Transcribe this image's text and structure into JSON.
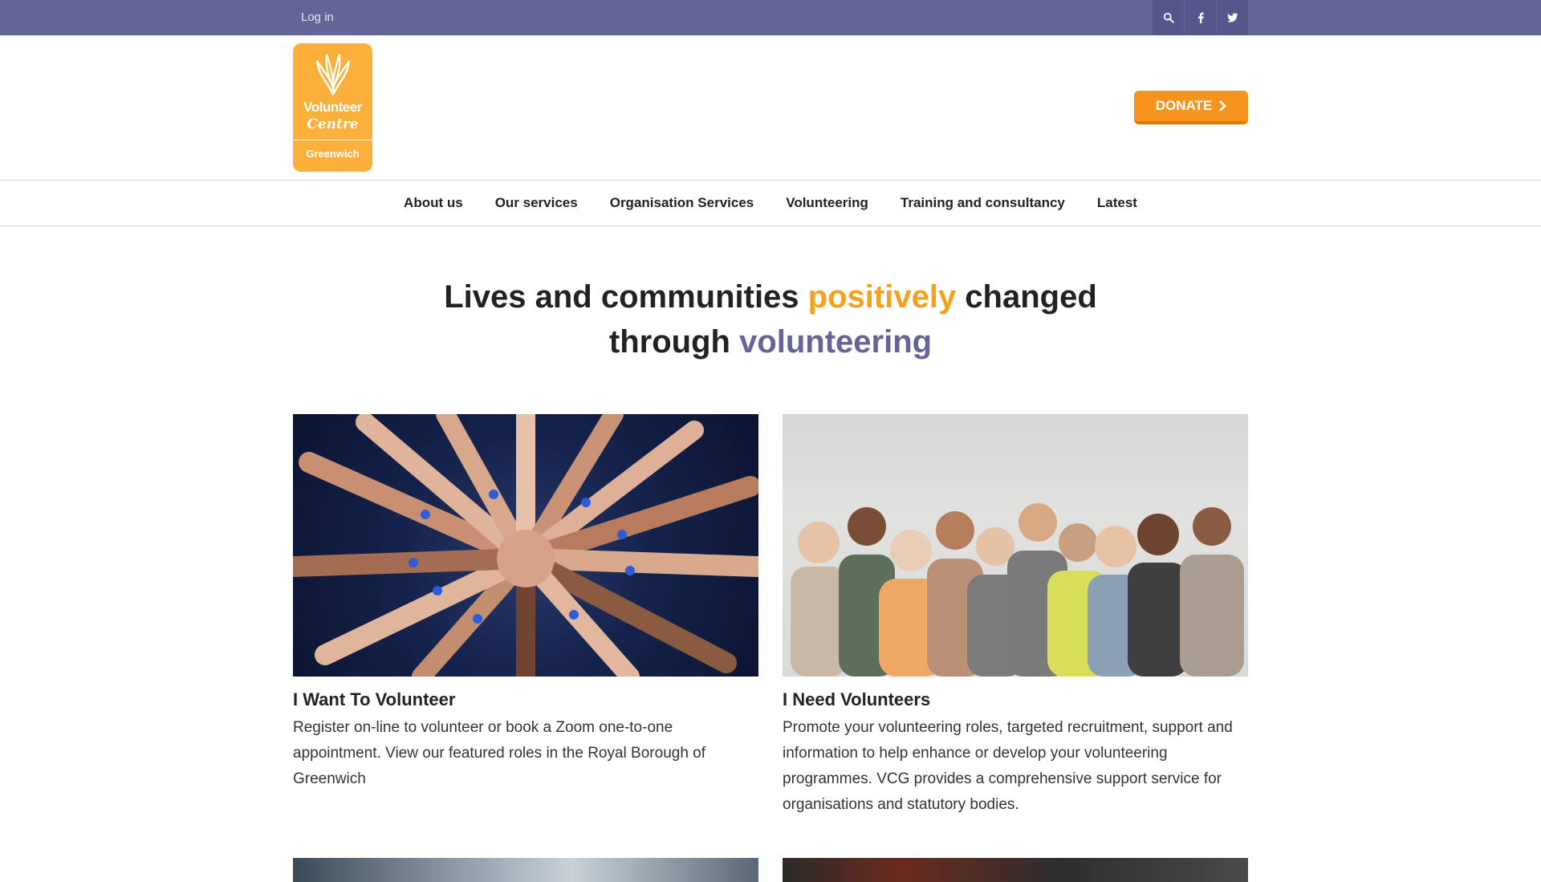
{
  "topbar": {
    "login": "Log in",
    "icons": [
      "search-icon",
      "facebook-icon",
      "twitter-icon"
    ]
  },
  "logo": {
    "line1": "Volunteer",
    "line2": "Centre",
    "line3": "Greenwich"
  },
  "header": {
    "donate_label": "DONATE"
  },
  "nav": {
    "items": [
      {
        "label": "About us"
      },
      {
        "label": "Our services"
      },
      {
        "label": "Organisation Services"
      },
      {
        "label": "Volunteering"
      },
      {
        "label": "Training and consultancy"
      },
      {
        "label": "Latest"
      }
    ]
  },
  "hero": {
    "part1": "Lives and communities ",
    "highlight1": "positively",
    "part2": " changed",
    "part3": "through ",
    "highlight2": "volunteering"
  },
  "cards": [
    {
      "title": "I Want To Volunteer",
      "text": "Register on-line to volunteer or book a Zoom one-to-one appointment. View our featured roles in the Royal Borough of Greenwich"
    },
    {
      "title": "I Need Volunteers",
      "text": "Promote your volunteering roles, targeted recruitment, support and information to help enhance or develop your volunteering programmes. VCG provides a comprehensive support service for organisations and statutory bodies."
    }
  ],
  "colors": {
    "brand_purple": "#636597",
    "brand_orange": "#fbb03b",
    "donate_orange": "#f7941d",
    "highlight_orange": "#f7a01d"
  }
}
